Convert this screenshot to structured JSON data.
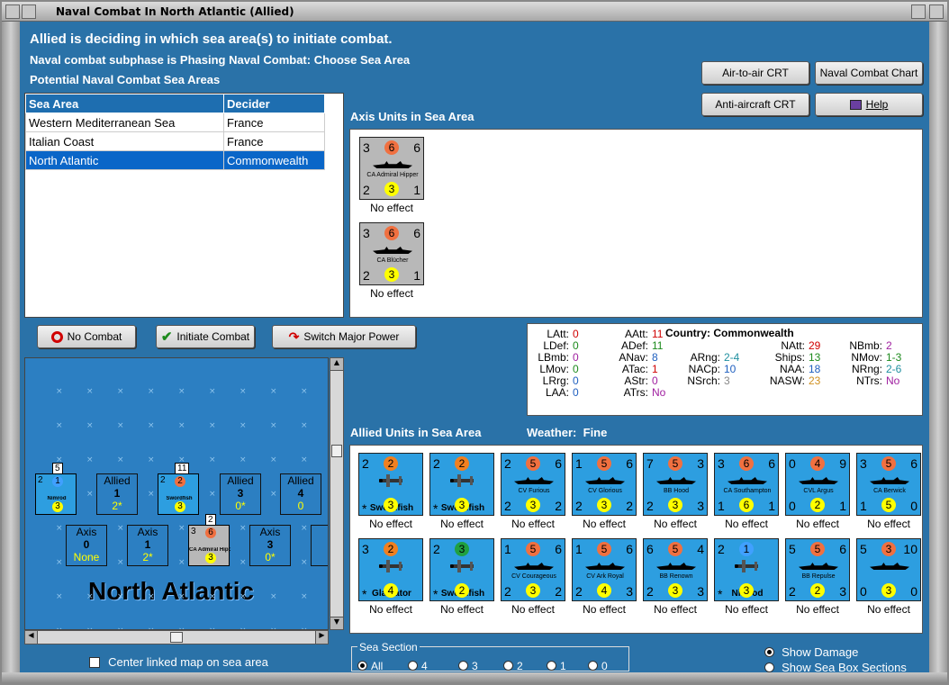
{
  "window": {
    "title": "Naval Combat In North Atlantic (Allied)"
  },
  "header": {
    "line1": "Allied is deciding in which sea area(s) to initiate combat.",
    "line2": "Naval combat subphase is Phasing Naval Combat: Choose Sea Area",
    "line3": "Potential Naval Combat Sea Areas"
  },
  "buttons": {
    "air_to_air": "Air-to-air CRT",
    "naval_chart": "Naval Combat Chart",
    "anti_aircraft": "Anti-aircraft CRT",
    "help": "Help",
    "no_combat": "No Combat",
    "initiate": "Initiate Combat",
    "switch": "Switch Major Power"
  },
  "sea_table": {
    "headers": [
      "Sea Area",
      "Decider"
    ],
    "rows": [
      {
        "area": "Western Mediterranean Sea",
        "decider": "France"
      },
      {
        "area": "Italian Coast",
        "decider": "France"
      },
      {
        "area": "North Atlantic",
        "decider": "Commonwealth"
      }
    ]
  },
  "axis_units": {
    "label": "Axis Units in Sea Area",
    "units": [
      {
        "tl": "3",
        "tc": "6",
        "tr": "6",
        "name": "CA Admiral Hipper",
        "bl": "2",
        "bc": "3",
        "br": "1",
        "effect": "No effect"
      },
      {
        "tl": "3",
        "tc": "6",
        "tr": "6",
        "name": "CA Blücher",
        "bl": "2",
        "bc": "3",
        "br": "1",
        "effect": "No effect"
      }
    ]
  },
  "stats": {
    "country_label": "Country:",
    "country": "Commonwealth",
    "items": [
      {
        "k": "LAtt:",
        "v": "0",
        "c": "#d00000"
      },
      {
        "k": "LDef:",
        "v": "0",
        "c": "#1c8a1c"
      },
      {
        "k": "LBmb:",
        "v": "0",
        "c": "#a020a0"
      },
      {
        "k": "LMov:",
        "v": "0",
        "c": "#1c8a1c"
      },
      {
        "k": "LRrg:",
        "v": "0",
        "c": "#2060c0"
      },
      {
        "k": "LAA:",
        "v": "0",
        "c": "#2060c0"
      },
      {
        "k": "AAtt:",
        "v": "11",
        "c": "#d00000"
      },
      {
        "k": "ADef:",
        "v": "11",
        "c": "#1c8a1c"
      },
      {
        "k": "ANav:",
        "v": "8",
        "c": "#2060c0"
      },
      {
        "k": "ATac:",
        "v": "1",
        "c": "#d00000"
      },
      {
        "k": "AStr:",
        "v": "0",
        "c": "#a020a0"
      },
      {
        "k": "ATrs:",
        "v": "No",
        "c": "#a020a0"
      },
      {
        "k": "ARng:",
        "v": "2-4",
        "c": "#2090a0"
      },
      {
        "k": "NACp:",
        "v": "10",
        "c": "#2060c0"
      },
      {
        "k": "NSrch:",
        "v": "3",
        "c": "#888888"
      },
      {
        "k": "NAtt:",
        "v": "29",
        "c": "#d00000"
      },
      {
        "k": "Ships:",
        "v": "13",
        "c": "#1c8a1c"
      },
      {
        "k": "NAA:",
        "v": "18",
        "c": "#2060c0"
      },
      {
        "k": "NASW:",
        "v": "23",
        "c": "#d09020"
      },
      {
        "k": "NBmb:",
        "v": "2",
        "c": "#a020a0"
      },
      {
        "k": "NMov:",
        "v": "1-3",
        "c": "#1c8a1c"
      },
      {
        "k": "NRng:",
        "v": "2-6",
        "c": "#2090a0"
      },
      {
        "k": "NTrs:",
        "v": "No",
        "c": "#a020a0"
      }
    ]
  },
  "allied_units": {
    "label": "Allied Units in Sea Area",
    "weather_label": "Weather:",
    "weather": "Fine",
    "units": [
      {
        "tl": "2",
        "tc": "2",
        "tr": "",
        "name": "Swordfish",
        "bl": "",
        "bc": "3",
        "br": "",
        "effect": "No effect",
        "kind": "plane",
        "tcc": "#f08020",
        "bcc": "#ffff00"
      },
      {
        "tl": "2",
        "tc": "2",
        "tr": "",
        "name": "Swordfish",
        "bl": "",
        "bc": "3",
        "br": "",
        "effect": "No effect",
        "kind": "plane",
        "tcc": "#f08020",
        "bcc": "#ffff00"
      },
      {
        "tl": "2",
        "tc": "5",
        "tr": "6",
        "name": "CV Furious",
        "bl": "2",
        "bc": "3",
        "br": "2",
        "effect": "No effect",
        "kind": "ship",
        "tcc": "#f07040",
        "bcc": "#ffff00"
      },
      {
        "tl": "1",
        "tc": "5",
        "tr": "6",
        "name": "CV Glorious",
        "bl": "2",
        "bc": "3",
        "br": "2",
        "effect": "No effect",
        "kind": "ship",
        "tcc": "#f07040",
        "bcc": "#ffff00"
      },
      {
        "tl": "7",
        "tc": "5",
        "tr": "3",
        "name": "BB Hood",
        "bl": "2",
        "bc": "3",
        "br": "3",
        "effect": "No effect",
        "kind": "ship",
        "tcc": "#f07040",
        "bcc": "#ffff00"
      },
      {
        "tl": "3",
        "tc": "6",
        "tr": "6",
        "name": "CA Southampton",
        "bl": "1",
        "bc": "6",
        "br": "1",
        "effect": "No effect",
        "kind": "ship",
        "tcc": "#f07040",
        "bcc": "#ffff00"
      },
      {
        "tl": "0",
        "tc": "4",
        "tr": "9",
        "name": "CVL Argus",
        "bl": "0",
        "bc": "2",
        "br": "1",
        "effect": "No effect",
        "kind": "ship",
        "tcc": "#f07040",
        "bcc": "#ffff00"
      },
      {
        "tl": "3",
        "tc": "5",
        "tr": "6",
        "name": "CA Berwick",
        "bl": "1",
        "bc": "5",
        "br": "0",
        "effect": "No effect",
        "kind": "ship",
        "tcc": "#f07040",
        "bcc": "#ffff00"
      },
      {
        "tl": "3",
        "tc": "2",
        "tr": "",
        "name": "Gladiator",
        "bl": "",
        "bc": "4",
        "br": "",
        "effect": "No effect",
        "kind": "plane",
        "tcc": "#f08020",
        "bcc": "#ffff00"
      },
      {
        "tl": "2",
        "tc": "3",
        "tr": "",
        "name": "Swordfish",
        "bl": "",
        "bc": "2",
        "br": "",
        "effect": "No effect",
        "kind": "plane",
        "tcc": "#20a040",
        "bcc": "#ffff00"
      },
      {
        "tl": "1",
        "tc": "5",
        "tr": "6",
        "name": "CV Courageous",
        "bl": "2",
        "bc": "3",
        "br": "2",
        "effect": "No effect",
        "kind": "ship",
        "tcc": "#f07040",
        "bcc": "#ffff00"
      },
      {
        "tl": "1",
        "tc": "5",
        "tr": "6",
        "name": "CV Ark Royal",
        "bl": "2",
        "bc": "4",
        "br": "3",
        "effect": "No effect",
        "kind": "ship",
        "tcc": "#f07040",
        "bcc": "#ffff00"
      },
      {
        "tl": "6",
        "tc": "5",
        "tr": "4",
        "name": "BB Renown",
        "bl": "2",
        "bc": "3",
        "br": "3",
        "effect": "No effect",
        "kind": "ship",
        "tcc": "#f07040",
        "bcc": "#ffff00"
      },
      {
        "tl": "2",
        "tc": "1",
        "tr": "",
        "name": "Nimrod",
        "bl": "",
        "bc": "3",
        "br": "",
        "effect": "No effect",
        "kind": "plane",
        "tcc": "#40a0ff",
        "bcc": "#ffff00"
      },
      {
        "tl": "5",
        "tc": "5",
        "tr": "6",
        "name": "BB Repulse",
        "bl": "2",
        "bc": "2",
        "br": "3",
        "effect": "No effect",
        "kind": "ship",
        "tcc": "#f07040",
        "bcc": "#ffff00"
      },
      {
        "tl": "5",
        "tc": "3",
        "tr": "10",
        "name": "",
        "bl": "0",
        "bc": "3",
        "br": "0",
        "effect": "No effect",
        "kind": "ship",
        "tcc": "#f07040",
        "bcc": "#ffff00"
      }
    ]
  },
  "map": {
    "area_name": "North Atlantic",
    "boxes": [
      {
        "side": "Allied",
        "num": "1",
        "sub": "2*"
      },
      {
        "side": "Allied",
        "num": "3",
        "sub": "0*"
      },
      {
        "side": "Allied",
        "num": "4",
        "sub": "0"
      },
      {
        "side": "Axis",
        "num": "0",
        "sub": "None"
      },
      {
        "side": "Axis",
        "num": "1",
        "sub": "2*"
      },
      {
        "side": "Axis",
        "num": "3",
        "sub": "0*"
      },
      {
        "side": "A",
        "num": "",
        "sub": ""
      }
    ],
    "stacks": [
      {
        "count": "5",
        "name": "Nimrod",
        "tc": "1",
        "bc": "3",
        "tl": "2",
        "bl": "",
        "br": ""
      },
      {
        "count": "11",
        "name": "Swordfish",
        "tc": "2",
        "bc": "3",
        "tl": "2",
        "bl": "",
        "br": ""
      },
      {
        "count": "2",
        "name": "CA Admiral Hipper",
        "tc": "6",
        "bc": "3",
        "tl": "3",
        "bl": "2",
        "br": "1"
      }
    ],
    "center_label": "Center linked map on sea area"
  },
  "sea_section": {
    "label": "Sea Section",
    "options": [
      "All",
      "4",
      "3",
      "2",
      "1",
      "0"
    ],
    "selected": "All"
  },
  "view_options": {
    "show_damage": "Show Damage",
    "show_sections": "Show Sea Box Sections"
  }
}
